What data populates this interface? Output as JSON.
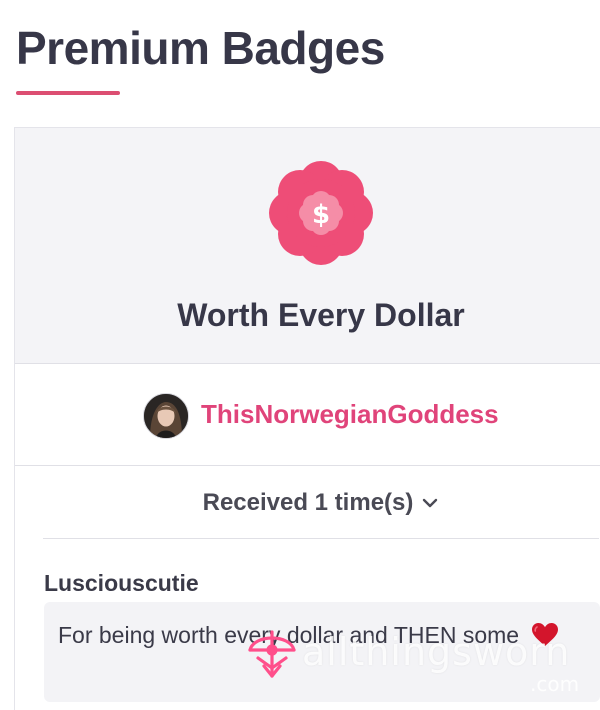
{
  "header": {
    "title": "Premium Badges",
    "accent_color": "#dc4e72"
  },
  "badge": {
    "name": "Worth Every Dollar",
    "icon": "dollar-flower-badge-icon",
    "icon_colors": {
      "outer": "#ee4d77",
      "inner": "#f58da7",
      "glyph": "#ffffff"
    }
  },
  "giver": {
    "username": "ThisNorwegianGoddess",
    "name_color": "#e0447a",
    "avatar": "avatar-photo"
  },
  "received": {
    "label": "Received 1 time(s)",
    "icon": "chevron-down-icon"
  },
  "comments": [
    {
      "author": "Lusciouscutie",
      "text": "For being worth every dollar and THEN some",
      "emoji": "heart-icon"
    }
  ],
  "watermark": {
    "text": "allthingsworn",
    "suffix": ".com"
  }
}
